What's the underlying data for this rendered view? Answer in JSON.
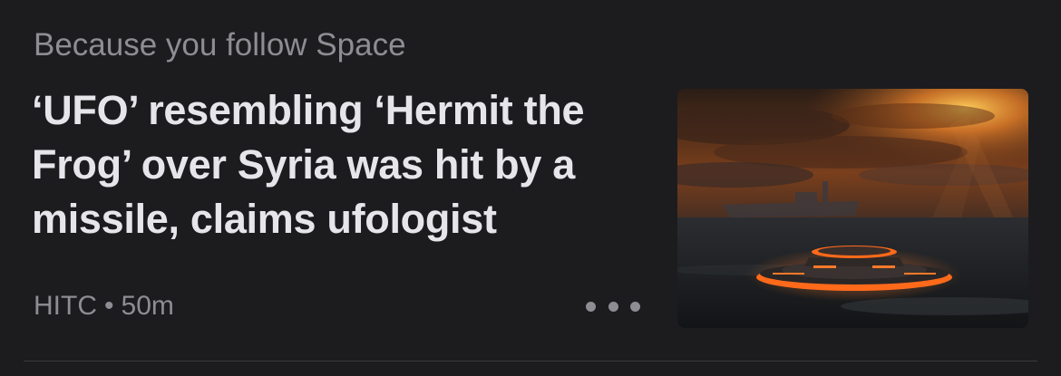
{
  "feed_item": {
    "context_label": "Because you follow Space",
    "headline": "‘UFO’ resembling ‘Hermit the Frog’ over Syria was hit by a missile, claims ufologist",
    "source": "HITC",
    "separator": "•",
    "age": "50m",
    "more_icon": "ellipsis-icon",
    "thumbnail_icon": "ufo-over-sea-image"
  },
  "colors": {
    "background": "#1c1c1e",
    "headline": "#e5e5ea",
    "secondary_text": "#8d8d93",
    "ufo_glow": "#ff6a1a"
  }
}
